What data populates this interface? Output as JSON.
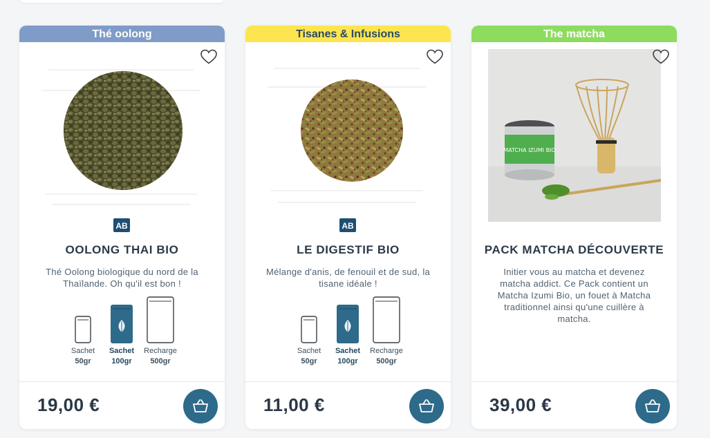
{
  "colors": {
    "oolong": "#7f9bc8",
    "tisanes": "#fce54f",
    "matcha": "#8ddc5f",
    "accent": "#2e6a8a",
    "category_text_light": "#ffffff",
    "category_text_dark": "#2b4a63"
  },
  "products": [
    {
      "category": "Thé oolong",
      "name": "OOLONG THAI BIO",
      "description": "Thé Oolong biologique du nord de la Thaïlande. Oh qu'il est bon !",
      "organic_logo": "AB",
      "image": "oolong-leaves-image",
      "favorite_icon": "heart-outline-icon",
      "formats": [
        {
          "name": "Sachet",
          "size": "50gr",
          "selected": false
        },
        {
          "name": "Sachet",
          "size": "100gr",
          "selected": true
        },
        {
          "name": "Recharge",
          "size": "500gr",
          "selected": false
        }
      ],
      "price": "19,00 €",
      "cart_icon": "basket-icon"
    },
    {
      "category": "Tisanes & Infusions",
      "name": "LE DIGESTIF BIO",
      "description": "Mélange d'anis, de fenouil et de sud, la tisane idéale !",
      "organic_logo": "AB",
      "image": "herbal-blend-image",
      "favorite_icon": "heart-outline-icon",
      "formats": [
        {
          "name": "Sachet",
          "size": "50gr",
          "selected": false
        },
        {
          "name": "Sachet",
          "size": "100gr",
          "selected": true
        },
        {
          "name": "Recharge",
          "size": "500gr",
          "selected": false
        }
      ],
      "price": "11,00 €",
      "cart_icon": "basket-icon"
    },
    {
      "category": "The matcha",
      "name": "PACK MATCHA DÉCOUVERTE",
      "description": "Initier vous au matcha et devenez matcha addict. Ce Pack contient un Matcha Izumi Bio, un fouet à Matcha traditionnel ainsi qu'une cuillère à matcha.",
      "image": "matcha-kit-image",
      "image_label": "MATCHA IZUMI BIO",
      "favorite_icon": "heart-outline-icon",
      "price": "39,00 €",
      "cart_icon": "basket-icon"
    }
  ]
}
